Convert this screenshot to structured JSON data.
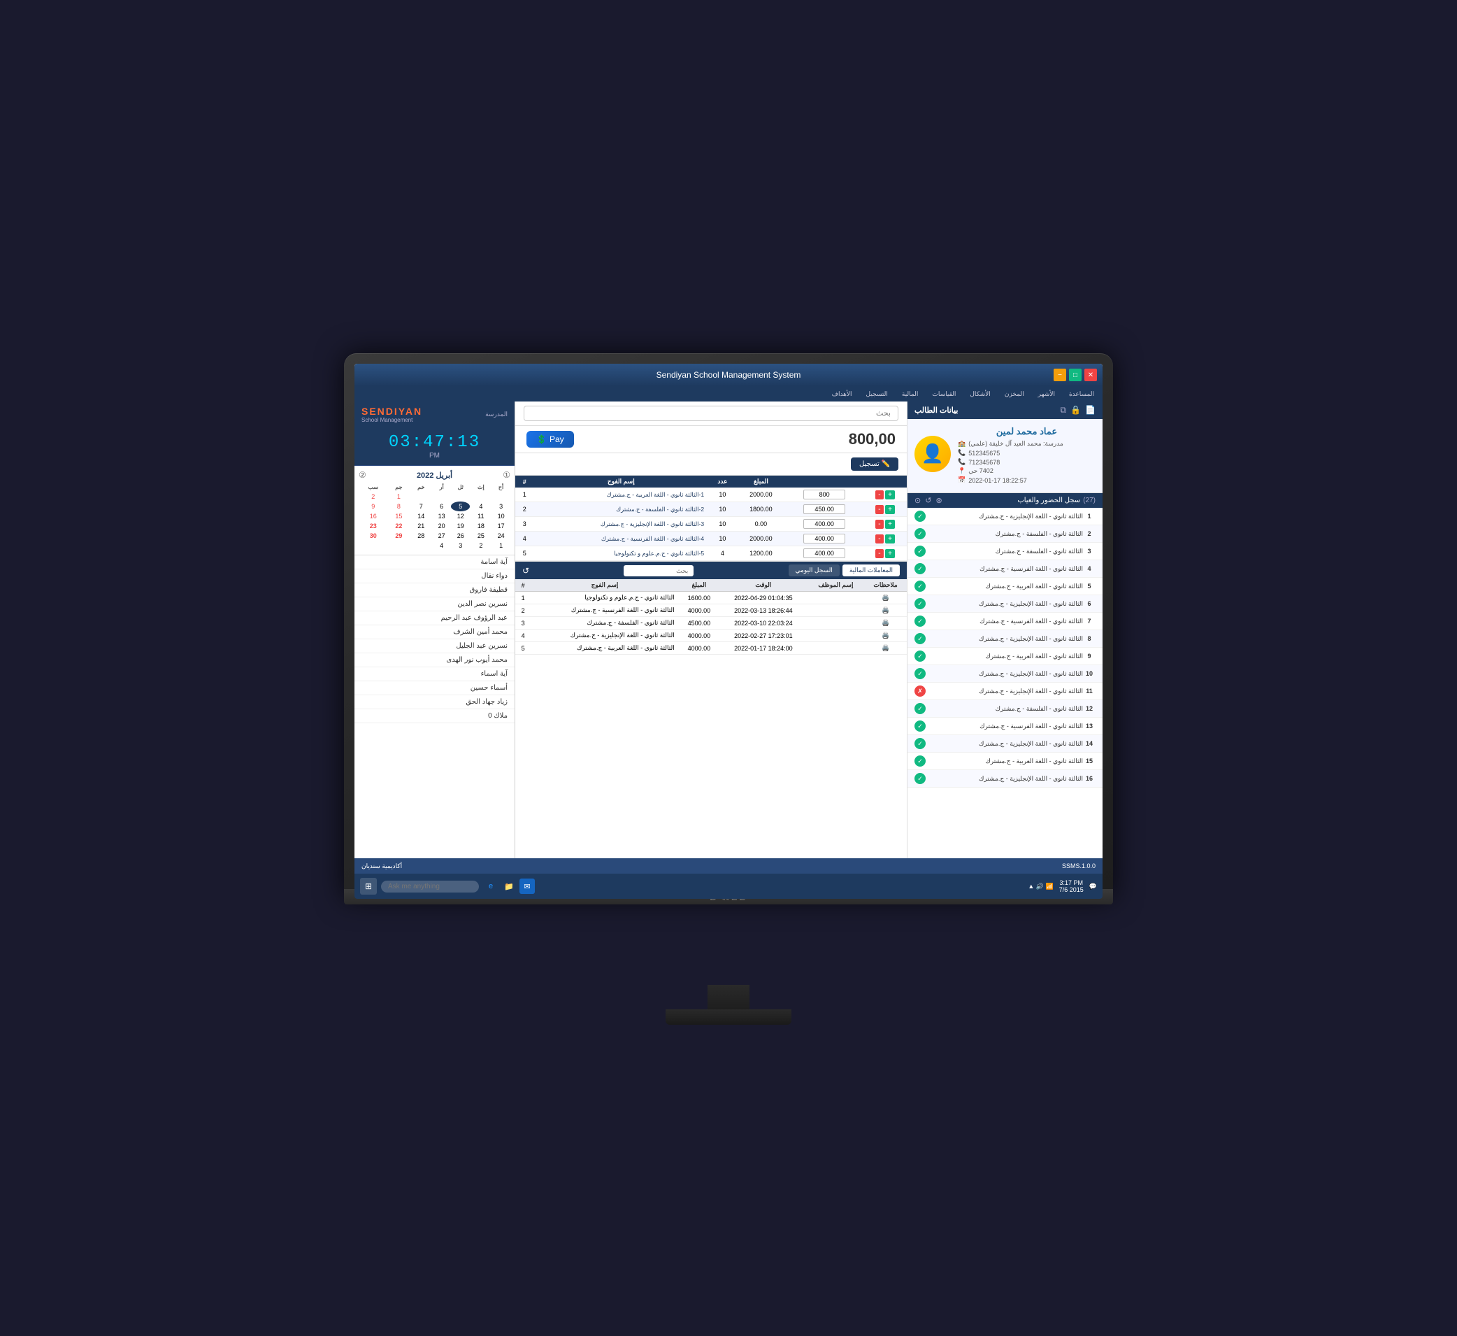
{
  "app": {
    "title": "Sendiyan School Management System",
    "logo": "SENDIYAN",
    "version": "SSMS.1.0.0"
  },
  "clock": {
    "time": "03:47:13",
    "ampm": "PM"
  },
  "calendar": {
    "title": "أبريل 2022",
    "days_of_week": [
      "الأحد",
      "الإثنين",
      "الثلاثاء",
      "الأربعاء",
      "الخميس",
      "الجمعة",
      "السبت"
    ],
    "days_short": [
      "الأحد",
      "الإثنين",
      "الثلاثاء",
      "الأربعاء",
      "الخميس",
      "الجمعة",
      "السبت"
    ]
  },
  "search": {
    "placeholder": "بحث"
  },
  "amount": {
    "value": "800,00"
  },
  "pay_button": {
    "label": "Pay"
  },
  "register_button": {
    "label": "تسجيل"
  },
  "fee_table": {
    "headers": [
      "#",
      "اسم الفوج",
      "",
      "",
      "المبلغ",
      ""
    ],
    "rows": [
      {
        "num": "1",
        "class": "الثالثة ثانوي - اللغة العربية - ج.مشترك",
        "amount": "2000.00",
        "qty": "10",
        "input": "800",
        "plus": "+",
        "minus": "-"
      },
      {
        "num": "2",
        "class": "الثالثة ثانوي - الفلسفة - ج.مشترك",
        "amount": "1800.00",
        "qty": "10",
        "input": "450.00",
        "plus": "+",
        "minus": "-"
      },
      {
        "num": "3",
        "class": "الثالثة ثانوي - اللغة الإنجليزية - ج.مشترك",
        "amount": "0.00",
        "qty": "10",
        "input": "400.00",
        "plus": "+",
        "minus": "-"
      },
      {
        "num": "4",
        "class": "الثالثة ثانوي - اللغة الفرنسية - ج.مشترك",
        "amount": "2000.00",
        "qty": "10",
        "input": "400.00",
        "plus": "+",
        "minus": "-"
      },
      {
        "num": "5",
        "class": "الثالثة ثانوي - ج.م.علوم و تكنولوجيا",
        "amount": "1200.00",
        "qty": "4",
        "input": "400.00",
        "plus": "+",
        "minus": "-"
      }
    ]
  },
  "transactions": {
    "tab_daily": "السجل اليومي",
    "tab_financial": "المعاملات المالية",
    "search_placeholder": "بحث",
    "headers": [
      "#",
      "إسم الفوج",
      "المبلغ",
      "الوقت",
      "إسم الموظف",
      "ملاحظات"
    ],
    "rows": [
      {
        "num": "1",
        "class": "الثالثة ثانوي - ج.م.علوم و تكنولوجيا",
        "amount": "1600.00",
        "time": "01:04:35 2022-04-29",
        "employee": "",
        "notes": ""
      },
      {
        "num": "2",
        "class": "الثالثة ثانوي - اللغة الفرنسية - ج.مشترك",
        "amount": "4000.00",
        "time": "18:26:44 2022-03-13",
        "employee": "",
        "notes": ""
      },
      {
        "num": "3",
        "class": "الثالثة ثانوي - الفلسفة - ج.مشترك",
        "amount": "4500.00",
        "time": "22:03:24 2022-03-10",
        "employee": "",
        "notes": ""
      },
      {
        "num": "4",
        "class": "الثالثة ثانوي - اللغة الإنجليزية - ج.مشترك",
        "amount": "4000.00",
        "time": "17:23:01 2022-02-27",
        "employee": "",
        "notes": ""
      },
      {
        "num": "5",
        "class": "الثالثة ثانوي - اللغة العربية - ج.مشترك",
        "amount": "4000.00",
        "time": "18:24:00 2022-01-17",
        "employee": "",
        "notes": ""
      }
    ]
  },
  "student": {
    "panel_title": "بيانات الطالب",
    "name": "عماد محمد لمين",
    "school": "مدرسة: محمد العيد آل خليفة (علمي)",
    "phone": "512345675",
    "phone2": "712345678",
    "neighborhood": "7402 حي",
    "datetime": "18:22:57 2022-01-17",
    "avatar": "👤"
  },
  "attendance": {
    "title": "سجل الحضور والغياب",
    "count": "(27)",
    "items": [
      {
        "num": "1",
        "text": "الثالثة ثانوي - اللغة الإنجليزية - ج.مشترك",
        "status": "green"
      },
      {
        "num": "2",
        "text": "الثالثة ثانوي - الفلسفة - ج.مشترك",
        "status": "green"
      },
      {
        "num": "3",
        "text": "الثالثة ثانوي - الفلسفة - ج.مشترك",
        "status": "green"
      },
      {
        "num": "4",
        "text": "الثالثة ثانوي - اللغة الفرنسية - ج.مشترك",
        "status": "green"
      },
      {
        "num": "5",
        "text": "الثالثة ثانوي - اللغة العربية - ج.مشترك",
        "status": "green"
      },
      {
        "num": "6",
        "text": "الثالثة ثانوي - اللغة الإنجليزية - ج.مشترك",
        "status": "green"
      },
      {
        "num": "7",
        "text": "الثالثة ثانوي - اللغة الفرنسية - ج.مشترك",
        "status": "green"
      },
      {
        "num": "8",
        "text": "الثالثة ثانوي - اللغة الإنجليزية - ج.مشترك",
        "status": "green"
      },
      {
        "num": "9",
        "text": "الثالثة ثانوي - اللغة العربية - ج.مشترك",
        "status": "green"
      },
      {
        "num": "10",
        "text": "الثالثة ثانوي - اللغة الإنجليزية - ج.مشترك",
        "status": "green"
      },
      {
        "num": "11",
        "text": "الثالثة ثانوي - اللغة الإنجليزية - ج.مشترك",
        "status": "red"
      },
      {
        "num": "12",
        "text": "الثالثة ثانوي - الفلسفة - ج.مشترك",
        "status": "green"
      },
      {
        "num": "13",
        "text": "الثالثة ثانوي - اللغة الفرنسية - ج.مشترك",
        "status": "green"
      },
      {
        "num": "14",
        "text": "الثالثة ثانوي - اللغة الإنجليزية - ج.مشترك",
        "status": "green"
      },
      {
        "num": "15",
        "text": "الثالثة ثانوي - اللغة العربية - ج.مشترك",
        "status": "green"
      },
      {
        "num": "16",
        "text": "الثالثة ثانوي - اللغة الإنجليزية - ج.مشترك",
        "status": "green"
      }
    ]
  },
  "students_list": [
    "آية اسامة",
    "دواء نقال",
    "قطيفة فاروق",
    "نسرين نصر الدين",
    "عبد الرؤوف عبد الرحيم",
    "محمد أمين الشرف",
    "نسرين عبد الجليل",
    "محمد أيوب نور الهدى",
    "آية اسماء",
    "أسماء حسين",
    "زياد جهاد الحق",
    "ملاك 0"
  ],
  "menu": {
    "items": [
      "الأهداف",
      "التسجيل",
      "المالية",
      "القياسات",
      "الأشكال",
      "المخزن",
      "الأشهر",
      "المساعدة"
    ]
  },
  "taskbar": {
    "time": "3:17 PM",
    "date": "7/6 2015",
    "search_placeholder": "Ask me anything",
    "bottom_text": "أكاديمية سنديان"
  }
}
